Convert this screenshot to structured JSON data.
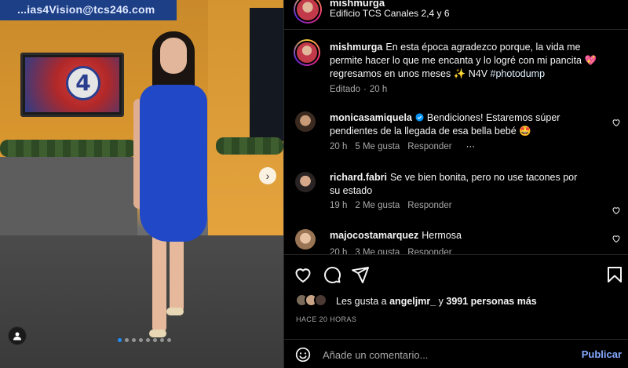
{
  "media": {
    "banner_text": "...ias4Vision@tcs246.com",
    "tv_logo": "4",
    "carousel": {
      "total": 8,
      "active_index": 0
    },
    "next_glyph": "›"
  },
  "header": {
    "username": "mishmurga",
    "location": "Edificio TCS Canales 2,4 y 6"
  },
  "caption": {
    "username": "mishmurga",
    "text": "En esta época agradezco porque, la vida me permite hacer lo que me encanta y lo logré con mi pancita 💖 regresamos en unos meses ✨  N4V ",
    "hashtag": "#photodump",
    "meta": [
      "Editado",
      "·",
      "20 h"
    ]
  },
  "comments": [
    {
      "username": "monicasamiquela",
      "verified": true,
      "text": "Bendiciones! Estaremos súper pendientes de la llegada de esa bella bebé 🤩",
      "time": "20 h",
      "likes": "5 Me gusta",
      "reply": "Responder",
      "more": "···"
    },
    {
      "username": "richard.fabri",
      "verified": false,
      "text": "Se ve bien bonita, pero no use tacones por su estado",
      "time": "19 h",
      "likes": "2 Me gusta",
      "reply": "Responder"
    },
    {
      "username": "majocostamarquez",
      "verified": false,
      "text": "Hermosa",
      "time": "20 h",
      "likes": "3 Me gusta",
      "reply": "Responder"
    }
  ],
  "likes": {
    "prefix": "Les gusta a ",
    "user": "angeljmr_",
    "middle": " y ",
    "count": "3991 personas más"
  },
  "timestamp": "HACE 20 HORAS",
  "add_comment": {
    "placeholder": "Añade un comentario...",
    "publish": "Publicar"
  },
  "colors": {
    "background": "#000000",
    "text": "#f5f5f5",
    "secondary": "#a8a8a8",
    "link": "#e0f1ff",
    "publish": "#85a9ff",
    "verified": "#0095f6",
    "carousel_active": "#1e90ff"
  },
  "icons": [
    "heart-icon",
    "comment-icon",
    "share-icon",
    "bookmark-icon",
    "emoji-icon",
    "tag-user-icon",
    "verified-badge-icon",
    "chevron-right-icon"
  ]
}
